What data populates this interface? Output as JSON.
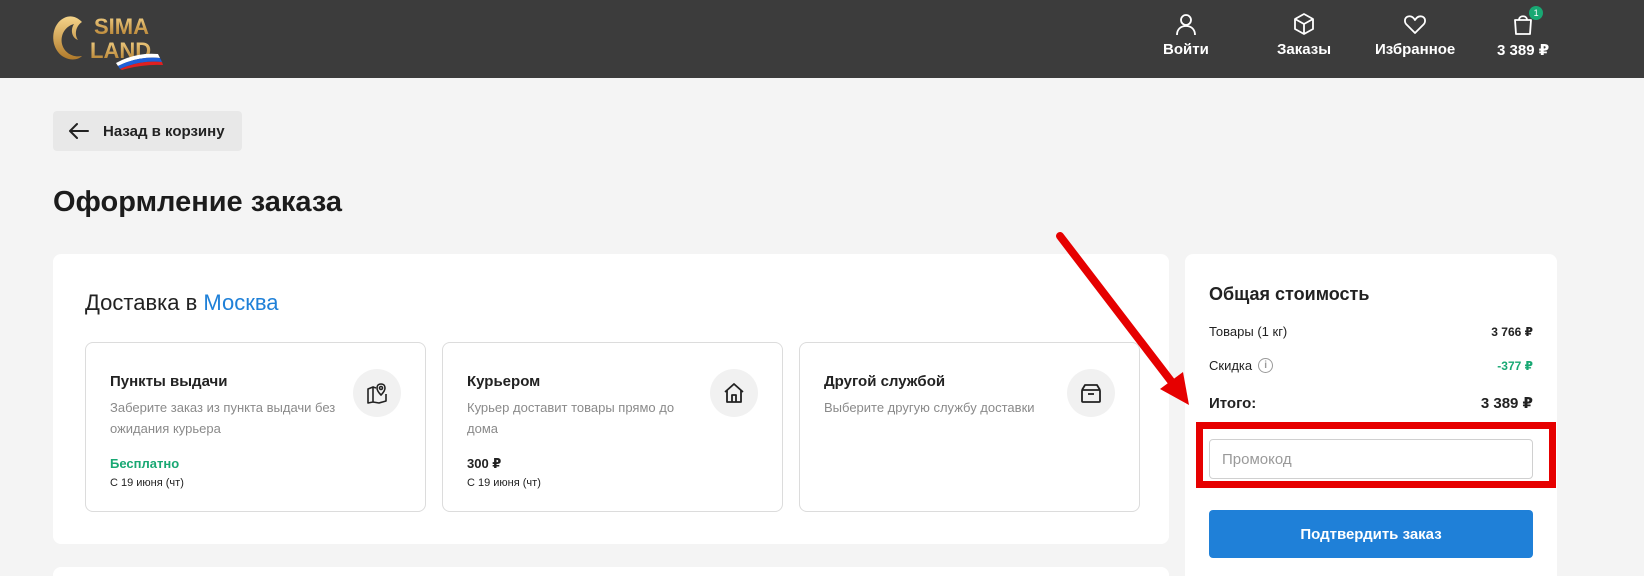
{
  "header": {
    "logo_text_top": "SIMA",
    "logo_text_bottom": "LAND",
    "nav": [
      {
        "label": "Войти",
        "icon": "user-icon"
      },
      {
        "label": "Заказы",
        "icon": "box-icon"
      },
      {
        "label": "Избранное",
        "icon": "heart-icon"
      },
      {
        "label": "3 389 ₽",
        "icon": "cart-icon",
        "badge": "1"
      }
    ]
  },
  "back_button": {
    "label": "Назад в корзину",
    "icon": "arrow-left-icon"
  },
  "page_title": "Оформление заказа",
  "delivery": {
    "title_prefix": "Доставка в",
    "city": "Москва",
    "options": [
      {
        "title": "Пункты выдачи",
        "description": "Заберите заказ из пункта выдачи без ожидания курьера",
        "price": "Бесплатно",
        "date": "С 19 июня (чт)",
        "icon": "map-pin-icon"
      },
      {
        "title": "Курьером",
        "description": "Курьер доставит товары прямо до дома",
        "price": "300 ₽",
        "date": "С 19 июня (чт)",
        "icon": "home-icon"
      },
      {
        "title": "Другой службой",
        "description": "Выберите другую службу доставки",
        "icon": "package-icon"
      }
    ]
  },
  "summary": {
    "title": "Общая стоимость",
    "goods_label": "Товары (1 кг)",
    "goods_value": "3 766 ₽",
    "discount_label": "Скидка",
    "discount_info_icon": "i",
    "discount_value": "-377 ₽",
    "total_label": "Итого:",
    "total_value": "3 389 ₽",
    "promo_placeholder": "Промокод",
    "confirm_label": "Подтвердить заказ"
  },
  "colors": {
    "header_bg": "#3c3c3c",
    "accent_blue": "#1f80d8",
    "green": "#18a873",
    "annotation_red": "#e60000"
  }
}
